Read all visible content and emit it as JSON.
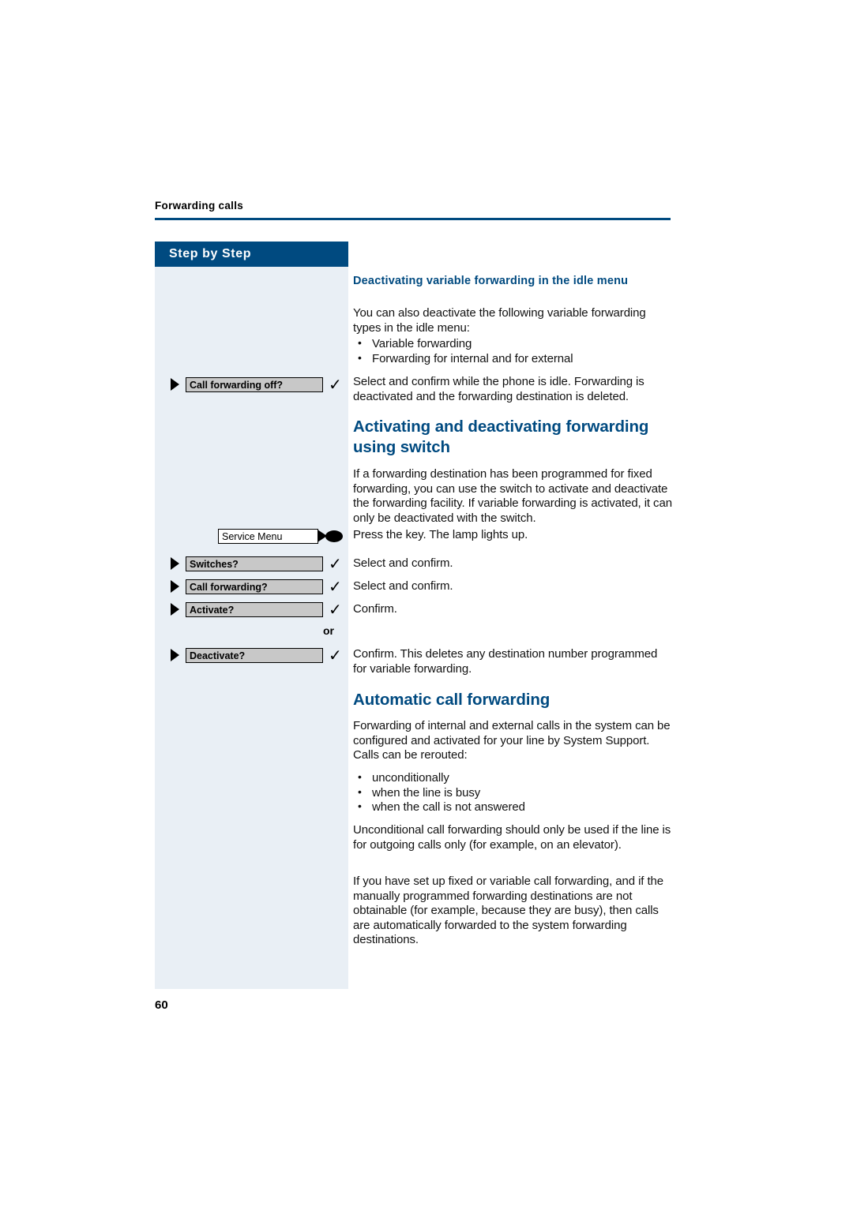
{
  "header": {
    "section_title": "Forwarding calls"
  },
  "sidebar": {
    "banner_label": "Step by Step",
    "display_rows": [
      {
        "label": "Call forwarding off?",
        "check": "✓"
      },
      {
        "label": "Service Menu",
        "check": ""
      },
      {
        "label": "Switches?",
        "check": "✓"
      },
      {
        "label": "Call forwarding?",
        "check": "✓"
      },
      {
        "label": "Activate?",
        "check": "✓"
      },
      {
        "label": "Deactivate?",
        "check": "✓"
      }
    ],
    "or_label": "or"
  },
  "main": {
    "subheading_1": "Deactivating variable forwarding in the idle menu",
    "para_1": "You can also deactivate the following variable forwarding types in the idle menu:",
    "list_1": [
      "Variable forwarding",
      "Forwarding for internal and for external"
    ],
    "para_2": "Select and confirm while the phone is idle. Forwarding is deactivated and the forwarding destination is deleted.",
    "heading_1": "Activating and deactivating forwarding using switch",
    "para_3": "If a forwarding destination has been programmed for fixed forwarding, you can use the switch to activate and deactivate the forwarding facility. If variable forwarding is activated, it can only be deactivated with the switch.",
    "step_1": "Press the key. The lamp lights up.",
    "step_2": "Select and confirm.",
    "step_3": "Select and confirm.",
    "step_4": "Confirm.",
    "step_5": "Confirm. This deletes any destination number programmed for variable forwarding.",
    "heading_2": "Automatic call forwarding",
    "para_4": "Forwarding of internal and external calls in the system can be configured and activated for your line by System Support. Calls can be rerouted:",
    "list_2": [
      "unconditionally",
      "when the line is busy",
      "when the call is not answered"
    ],
    "para_5": "Unconditional call forwarding should only be used if the line is for outgoing calls only (for example, on an elevator).",
    "para_6": "If you have set up fixed or variable call forwarding, and if the manually programmed forwarding destinations are not obtainable (for example, because they are busy), then calls are automatically forwarded to the system forwarding destinations."
  },
  "footer": {
    "page_number": "60"
  },
  "colors": {
    "accent": "#004a80",
    "sidebar_bg": "#e9eff5",
    "lcd_bg": "#c8c8c8"
  }
}
